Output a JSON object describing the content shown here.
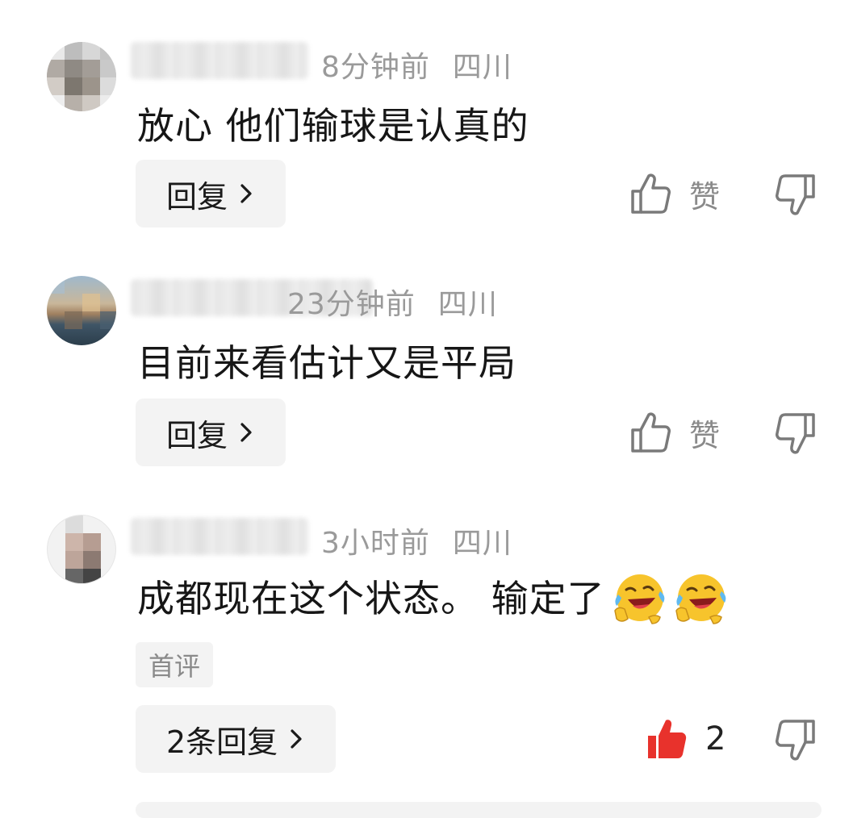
{
  "comments": [
    {
      "time": "8分钟前",
      "location": "四川",
      "text": "放心 他们输球是认真的",
      "reply_label": "回复",
      "like_label": "赞",
      "liked": false
    },
    {
      "time": "23分钟前",
      "location": "四川",
      "text": "目前来看估计又是平局",
      "reply_label": "回复",
      "like_label": "赞",
      "liked": false
    },
    {
      "time": "3小时前",
      "location": "四川",
      "text": "成都现在这个状态。 输定了",
      "emoji": [
        "rofl-emoji",
        "rofl-emoji"
      ],
      "badge": "首评",
      "reply_label": "2条回复",
      "like_count": "2",
      "liked": true,
      "liked_color": "#e8322c"
    }
  ],
  "icons": {
    "like": "thumbs-up-icon",
    "dislike": "thumbs-down-icon",
    "reply_chevron": "chevron-right-icon"
  }
}
